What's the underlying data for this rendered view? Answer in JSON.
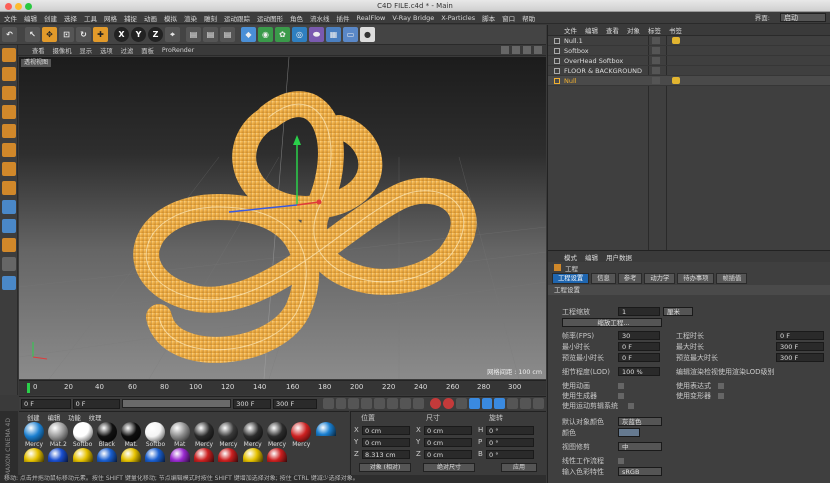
{
  "window": {
    "title": "C4D FILE.c4d * - Main"
  },
  "menubar": {
    "items": [
      "文件",
      "编辑",
      "创建",
      "选择",
      "工具",
      "网格",
      "捕捉",
      "动画",
      "模拟",
      "渲染",
      "雕刻",
      "运动跟踪",
      "运动图形",
      "角色",
      "流水线",
      "插件",
      "RealFlow",
      "V-Ray Bridge",
      "X-Particles",
      "脚本",
      "窗口",
      "帮助"
    ],
    "layout_label": "界面:",
    "layout_value": "启动"
  },
  "viewport": {
    "menu": [
      "查看",
      "摄像机",
      "显示",
      "选项",
      "过滤",
      "面板",
      "ProRender"
    ],
    "label": "透视视图",
    "grid_spacing": "网格间距 : 100 cm"
  },
  "timeline": {
    "ticks": [
      "0",
      "20",
      "40",
      "60",
      "80",
      "100",
      "120",
      "140",
      "160",
      "180",
      "200",
      "220",
      "240",
      "260",
      "280",
      "300"
    ],
    "current_frame": "0 F",
    "start": "0 F",
    "end": "300 F",
    "end2": "300 F"
  },
  "materials": {
    "menu": [
      "创建",
      "编辑",
      "功能",
      "纹理"
    ],
    "row1": [
      {
        "name": "Mercy",
        "color": "#1a7fd0"
      },
      {
        "name": "Mat.2",
        "color": "#9a9a9a"
      },
      {
        "name": "Softbo",
        "color": "#ffffff"
      },
      {
        "name": "Black",
        "color": "#111111"
      },
      {
        "name": "Mat.",
        "color": "#0d0d0d"
      },
      {
        "name": "Softbo",
        "color": "#f4f4f4"
      },
      {
        "name": "Mat",
        "color": "#8c8c8c"
      },
      {
        "name": "Mercy",
        "color": "#2a2a2a"
      },
      {
        "name": "Mercy",
        "color": "#3a3a3a"
      },
      {
        "name": "Mercy",
        "color": "#2c2c2c"
      },
      {
        "name": "Mercy",
        "color": "#2c2c2c"
      },
      {
        "name": "Mercy",
        "color": "#cc2020"
      }
    ],
    "row2": [
      "#1a7fd0",
      "#e6c200",
      "#1a4fd0",
      "#e6c200",
      "#1a5fd0",
      "#e6c200",
      "#1a5fd0",
      "#9a2ad0",
      "#cc2020",
      "#cc2020",
      "#e6c200",
      "#cc2020"
    ]
  },
  "coords": {
    "headers": {
      "pos": "位置",
      "size": "尺寸",
      "rot": "旋转"
    },
    "rows": [
      {
        "a": "X",
        "pos": "0 cm",
        "s": "X",
        "size": "0 cm",
        "r": "H",
        "rot": "0 °"
      },
      {
        "a": "Y",
        "pos": "0 cm",
        "s": "Y",
        "size": "0 cm",
        "r": "P",
        "rot": "0 °"
      },
      {
        "a": "Z",
        "pos": "8.313 cm",
        "s": "Z",
        "size": "0 cm",
        "r": "B",
        "rot": "0 °"
      }
    ],
    "mode1": "对象 (相对)",
    "mode2": "绝对尺寸",
    "apply": "应用"
  },
  "objects": {
    "menu": [
      "文件",
      "编辑",
      "查看",
      "对象",
      "标签",
      "书签"
    ],
    "rows": [
      {
        "name": "Null.1",
        "active": false
      },
      {
        "name": "Softbox",
        "active": false
      },
      {
        "name": "OverHead Softbox",
        "active": false
      },
      {
        "name": "FLOOR & BACKGROUND",
        "active": false
      },
      {
        "name": "Null",
        "active": true
      }
    ]
  },
  "attributes": {
    "menu": [
      "模式",
      "编辑",
      "用户数据"
    ],
    "title": "工程",
    "tabs": [
      "工程设置",
      "信息",
      "参考",
      "动力学",
      "待办事项",
      "帧插值"
    ],
    "section1": "工程设置",
    "scale_label": "工程缩放",
    "scale_value": "1",
    "scale_unit": "厘米",
    "scale_btn": "缩放工程...",
    "fps_label": "帧率(FPS)",
    "fps": "30",
    "duration_label": "工程时长",
    "duration": "0 F",
    "min_label": "最小时长",
    "min": "0 F",
    "max_label": "最大时长",
    "max": "300 F",
    "pmin_label": "预览最小时长",
    "pmin": "0 F",
    "pmax_label": "预览最大时长",
    "pmax": "300 F",
    "lod_label": "细节程度(LOD)",
    "lod": "100 %",
    "lod2": "编辑渲染检视使用渲染LOD级别",
    "c1": "使用动画",
    "c2": "使用表达式",
    "c3": "使用生成器",
    "c4": "使用变形器",
    "c5": "使用运动剪辑系统",
    "objcolor_label": "默认对象颜色",
    "objcolor": "灰蓝色",
    "color_label": "颜色",
    "section2": "视图修剪",
    "clip": "中",
    "lin_label": "线性工作流程",
    "input_label": "输入色彩特性",
    "input": "sRGB"
  },
  "status": "移动: 点击并拖动鼠标移动元素。按住 SHIFT 键量化移动; 节点编辑模式时按住 SHIFT 键增加选择对象; 按住 CTRL 键减少选择对象。"
}
